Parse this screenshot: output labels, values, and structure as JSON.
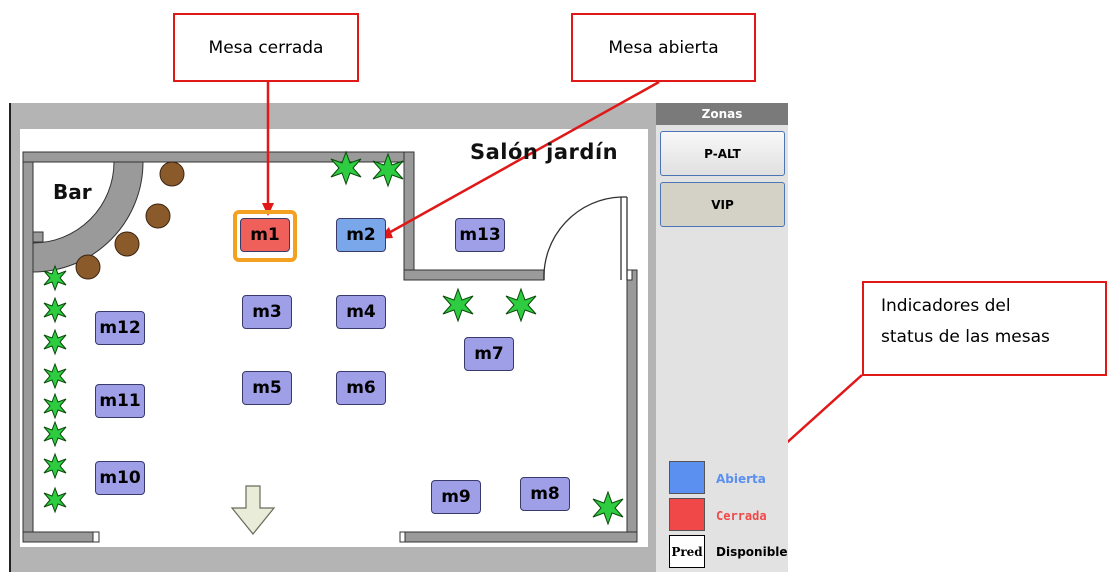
{
  "callouts": {
    "mesa_cerrada": "Mesa cerrada",
    "mesa_abierta": "Mesa abierta",
    "indicadores_line1": "Indicadores del",
    "indicadores_line2": "status de las mesas"
  },
  "room": {
    "title": "Salón jardín",
    "bar_label": "Bar"
  },
  "tables": [
    {
      "id": "m1",
      "status": "cerrada",
      "selected": true
    },
    {
      "id": "m2",
      "status": "abierta"
    },
    {
      "id": "m13",
      "status": "disponible"
    },
    {
      "id": "m3",
      "status": "disponible"
    },
    {
      "id": "m4",
      "status": "disponible"
    },
    {
      "id": "m12",
      "status": "disponible"
    },
    {
      "id": "m7",
      "status": "disponible"
    },
    {
      "id": "m5",
      "status": "disponible"
    },
    {
      "id": "m6",
      "status": "disponible"
    },
    {
      "id": "m11",
      "status": "disponible"
    },
    {
      "id": "m10",
      "status": "disponible"
    },
    {
      "id": "m9",
      "status": "disponible"
    },
    {
      "id": "m8",
      "status": "disponible"
    }
  ],
  "zones": {
    "header": "Zonas",
    "buttons": [
      "P-ALT",
      "VIP"
    ]
  },
  "legend": {
    "abierta": {
      "label": "Abierta",
      "color": "#5b8ff0"
    },
    "cerrada": {
      "label": "Cerrada",
      "color": "#f04848"
    },
    "disponible": {
      "label": "Disponible",
      "swatch_text": "Pred"
    }
  },
  "colors": {
    "callout_border": "#e01818",
    "table_available": "#9f9fe8",
    "table_open": "#7aa6ea",
    "table_closed": "#f0605a",
    "selection_ring": "#f4a020"
  }
}
